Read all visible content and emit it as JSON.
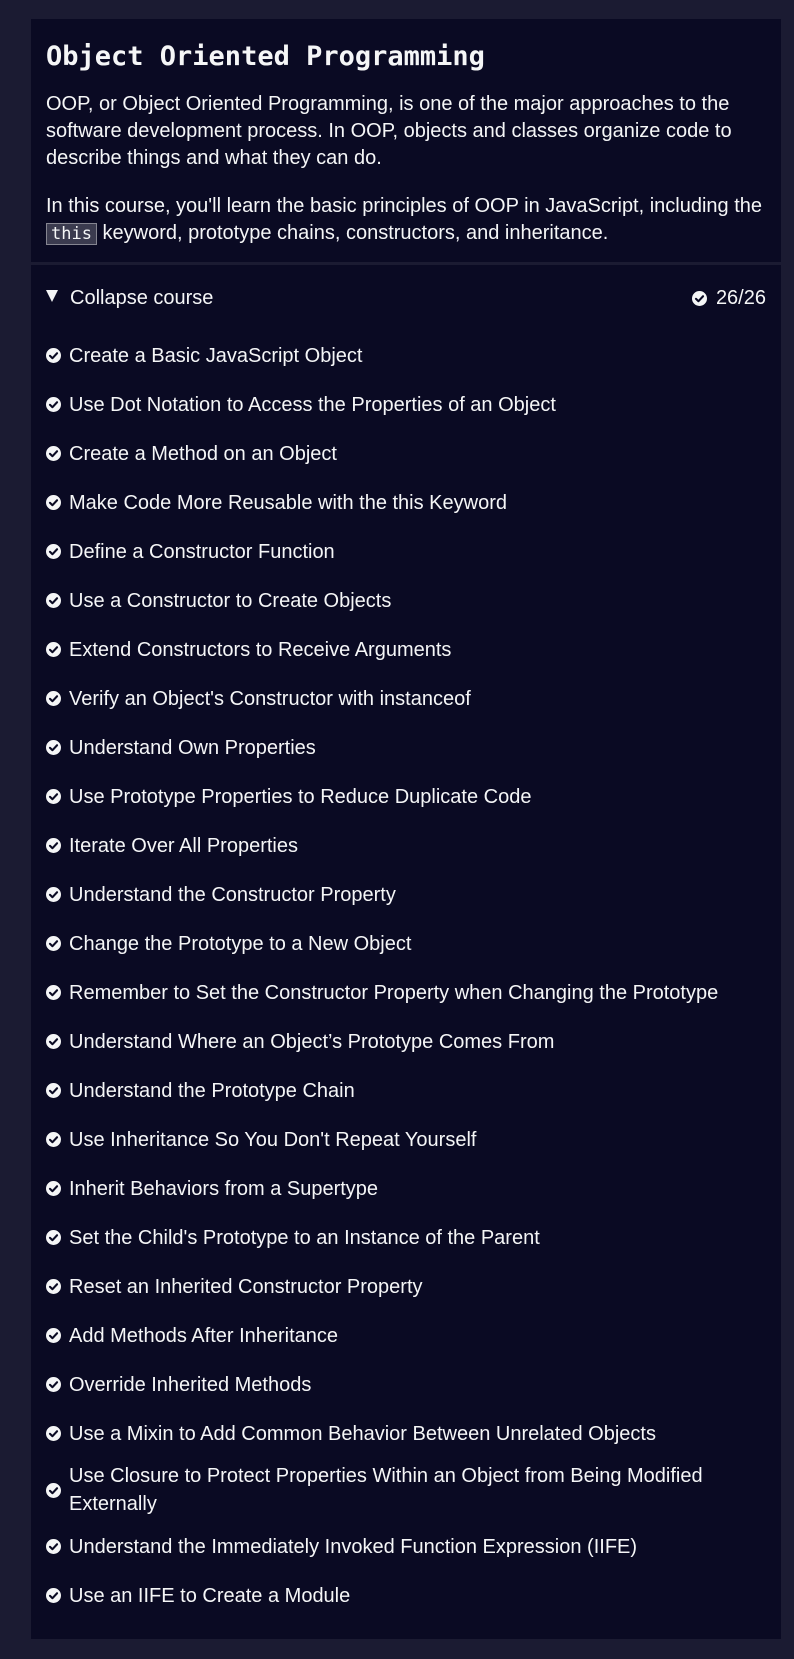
{
  "course": {
    "title": "Object Oriented Programming",
    "intro_1": "OOP, or Object Oriented Programming, is one of the major approaches to the software development process. In OOP, objects and classes organize code to describe things and what they can do.",
    "intro_2_before": "In this course, you'll learn the basic principles of OOP in JavaScript, including the ",
    "intro_2_code": "this",
    "intro_2_after": " keyword, prototype chains, constructors, and inheritance.",
    "collapse_label": "Collapse course",
    "progress": "26/26",
    "completed": 26,
    "total": 26
  },
  "icons": {
    "caret": "caret-down-icon",
    "check": "check-circle-icon"
  },
  "colors": {
    "background": "#1b1b32",
    "card": "#0a0a23",
    "text": "#f5f6f7"
  },
  "lessons": [
    {
      "title": "Create a Basic JavaScript Object",
      "completed": true
    },
    {
      "title": "Use Dot Notation to Access the Properties of an Object",
      "completed": true
    },
    {
      "title": "Create a Method on an Object",
      "completed": true
    },
    {
      "title": "Make Code More Reusable with the this Keyword",
      "completed": true
    },
    {
      "title": "Define a Constructor Function",
      "completed": true
    },
    {
      "title": "Use a Constructor to Create Objects",
      "completed": true
    },
    {
      "title": "Extend Constructors to Receive Arguments",
      "completed": true
    },
    {
      "title": "Verify an Object's Constructor with instanceof",
      "completed": true
    },
    {
      "title": "Understand Own Properties",
      "completed": true
    },
    {
      "title": "Use Prototype Properties to Reduce Duplicate Code",
      "completed": true
    },
    {
      "title": "Iterate Over All Properties",
      "completed": true
    },
    {
      "title": "Understand the Constructor Property",
      "completed": true
    },
    {
      "title": "Change the Prototype to a New Object",
      "completed": true
    },
    {
      "title": "Remember to Set the Constructor Property when Changing the Prototype",
      "completed": true
    },
    {
      "title": "Understand Where an Object’s Prototype Comes From",
      "completed": true
    },
    {
      "title": "Understand the Prototype Chain",
      "completed": true
    },
    {
      "title": "Use Inheritance So You Don't Repeat Yourself",
      "completed": true
    },
    {
      "title": "Inherit Behaviors from a Supertype",
      "completed": true
    },
    {
      "title": "Set the Child's Prototype to an Instance of the Parent",
      "completed": true
    },
    {
      "title": "Reset an Inherited Constructor Property",
      "completed": true
    },
    {
      "title": "Add Methods After Inheritance",
      "completed": true
    },
    {
      "title": "Override Inherited Methods",
      "completed": true
    },
    {
      "title": "Use a Mixin to Add Common Behavior Between Unrelated Objects",
      "completed": true
    },
    {
      "title": "Use Closure to Protect Properties Within an Object from Being Modified Externally",
      "completed": true
    },
    {
      "title": "Understand the Immediately Invoked Function Expression (IIFE)",
      "completed": true
    },
    {
      "title": "Use an IIFE to Create a Module",
      "completed": true
    }
  ]
}
